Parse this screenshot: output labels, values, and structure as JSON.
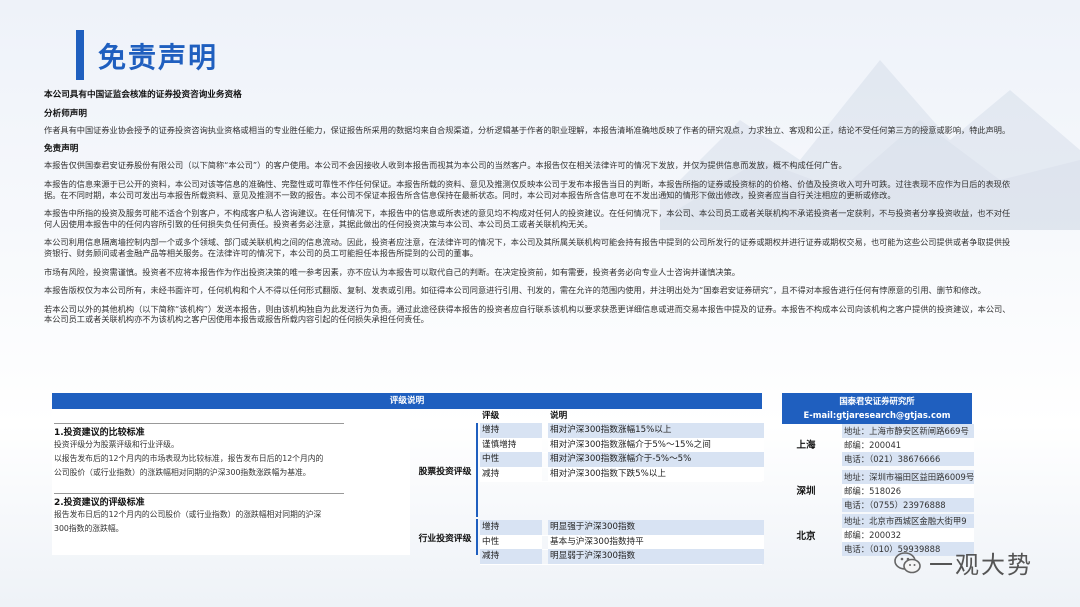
{
  "page": {
    "title": "免责声明",
    "accent_color": "#1f5fbf"
  },
  "body": {
    "qualification": "本公司具有中国证监会核准的证券投资咨询业务资格",
    "analyst_heading": "分析师声明",
    "analyst_text": "作者具有中国证券业协会授予的证券投资咨询执业资格或相当的专业胜任能力，保证报告所采用的数据均来自合规渠道，分析逻辑基于作者的职业理解，本报告清晰准确地反映了作者的研究观点，力求独立、客观和公正，结论不受任何第三方的授意或影响，特此声明。",
    "disclaimer_heading": "免责声明",
    "p1": "本报告仅供国泰君安证券股份有限公司（以下简称“本公司”）的客户使用。本公司不会因接收人收到本报告而视其为本公司的当然客户。本报告仅在相关法律许可的情况下发放，并仅为提供信息而发放，概不构成任何广告。",
    "p2": "本报告的信息来源于已公开的资料，本公司对该等信息的准确性、完整性或可靠性不作任何保证。本报告所载的资料、意见及推测仅反映本公司于发布本报告当日的判断，本报告所指的证券或投资标的的价格、价值及投资收入可升可跌。过往表现不应作为日后的表现依据。在不同时期，本公司可发出与本报告所载资料、意见及推测不一致的报告。本公司不保证本报告所含信息保持在最新状态。同时，本公司对本报告所含信息可在不发出通知的情形下做出修改，投资者应当自行关注相应的更新或修改。",
    "p3": "本报告中所指的投资及服务可能不适合个别客户，不构成客户私人咨询建议。在任何情况下，本报告中的信息或所表述的意见均不构成对任何人的投资建议。在任何情况下，本公司、本公司员工或者关联机构不承诺投资者一定获利，不与投资者分享投资收益，也不对任何人因使用本报告中的任何内容所引致的任何损失负任何责任。投资者务必注意，其据此做出的任何投资决策与本公司、本公司员工或者关联机构无关。",
    "p4": "本公司利用信息隔离墙控制内部一个或多个领域、部门或关联机构之间的信息流动。因此，投资者应注意，在法律许可的情况下，本公司及其所属关联机构可能会持有报告中提到的公司所发行的证券或期权并进行证券或期权交易，也可能为这些公司提供或者争取提供投资银行、财务顾问或者金融产品等相关服务。在法律许可的情况下，本公司的员工可能担任本报告所提到的公司的董事。",
    "p5": "市场有风险，投资需谨慎。投资者不应将本报告作为作出投资决策的唯一参考因素，亦不应认为本报告可以取代自己的判断。在决定投资前，如有需要，投资者务必向专业人士咨询并谨慎决策。",
    "p6": "本报告版权仅为本公司所有，未经书面许可，任何机构和个人不得以任何形式翻版、复制、发表或引用。如征得本公司同意进行引用、刊发的，需在允许的范围内使用，并注明出处为“国泰君安证券研究”，且不得对本报告进行任何有悖原意的引用、删节和修改。",
    "p7": "若本公司以外的其他机构（以下简称“该机构”）发送本报告，则由该机构独自为此发送行为负责。通过此途径获得本报告的投资者应自行联系该机构以要求获悉更详细信息或进而交易本报告中提及的证券。本报告不构成本公司向该机构之客户提供的投资建议，本公司、本公司员工或者关联机构亦不为该机构之客户因使用本报告或报告所载内容引起的任何损失承担任何责任。"
  },
  "rating": {
    "title": "评级说明",
    "col_rating": "评级",
    "col_desc": "说明",
    "left1_title": "1.投资建议的比较标准",
    "left1_line1": "投资评级分为股票评级和行业评级。",
    "left1_line2": "以报告发布后的12个月内的市场表现为比较标准，报告发布日后的12个月内的",
    "left1_line3": "公司股价（或行业指数）的涨跌幅相对同期的沪深300指数涨跌幅为基准。",
    "left2_title": "2.投资建议的评级标准",
    "left2_line1": "报告发布日后的12个月内的公司股价（或行业指数）的涨跌幅相对同期的沪深",
    "left2_line2": "300指数的涨跌幅。",
    "stock_label": "股票投资评级",
    "industry_label": "行业投资评级",
    "stock_rows": [
      {
        "rating": "增持",
        "desc": "相对沪深300指数涨幅15%以上"
      },
      {
        "rating": "谨慎增持",
        "desc": "相对沪深300指数涨幅介于5%～15%之间"
      },
      {
        "rating": "中性",
        "desc": "相对沪深300指数涨幅介于-5%～5%"
      },
      {
        "rating": "减持",
        "desc": "相对沪深300指数下跌5%以上"
      }
    ],
    "industry_rows": [
      {
        "rating": "增持",
        "desc": "明显强于沪深300指数"
      },
      {
        "rating": "中性",
        "desc": "基本与沪深300指数持平"
      },
      {
        "rating": "减持",
        "desc": "明显弱于沪深300指数"
      }
    ]
  },
  "contact": {
    "institute": "国泰君安证券研究所",
    "email": "E-mail:gtjaresearch@gtjas.com",
    "shanghai": {
      "city": "上海",
      "addr": "地址：上海市静安区新闸路669号",
      "zip": "邮编：200041",
      "tel": "电话：（021）38676666"
    },
    "shenzhen": {
      "city": "深圳",
      "addr": "地址：深圳市福田区益田路6009号",
      "zip": "邮编：518026",
      "tel": "电话：（0755）23976888"
    },
    "beijing": {
      "city": "北京",
      "addr": "地址：北京市西城区金融大街甲9",
      "zip": "邮编：200032",
      "tel": "电话：（010）59939888"
    }
  },
  "watermark": {
    "text": "一观大势",
    "icon": "wechat-icon"
  }
}
